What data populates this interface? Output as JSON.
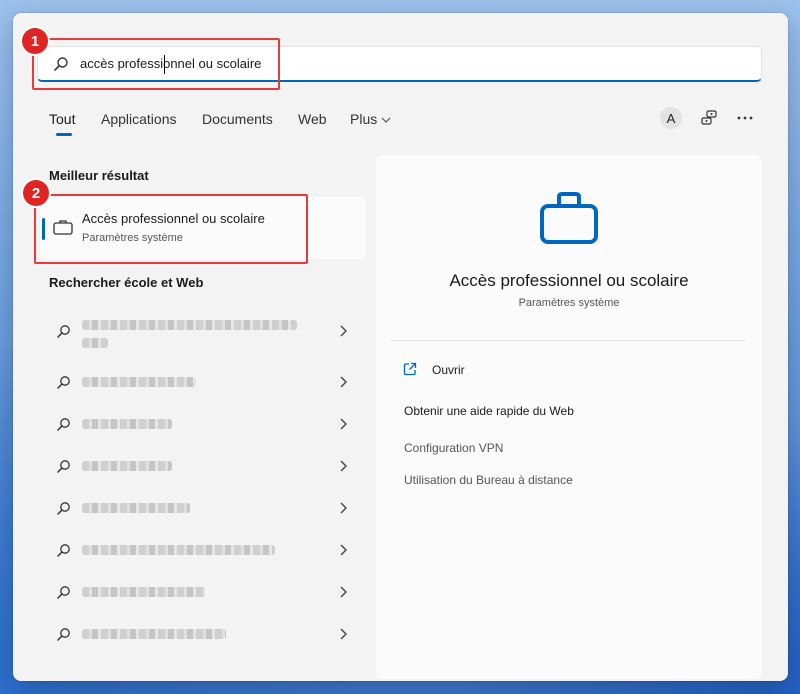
{
  "search": {
    "value": "accès professionnel ou scolaire"
  },
  "tabs": [
    {
      "label": "Tout"
    },
    {
      "label": "Applications"
    },
    {
      "label": "Documents"
    },
    {
      "label": "Web"
    },
    {
      "label": "Plus"
    }
  ],
  "toolbar": {
    "avatar_letter": "A"
  },
  "best_match": {
    "heading": "Meilleur résultat",
    "title": "Accès professionnel ou scolaire",
    "subtitle": "Paramètres système"
  },
  "web_section": {
    "heading": "Rechercher école et Web"
  },
  "details": {
    "title": "Accès professionnel ou scolaire",
    "subtitle": "Paramètres système",
    "open_label": "Ouvrir",
    "help_heading": "Obtenir une aide rapide du Web",
    "links": [
      "Configuration VPN",
      "Utilisation du Bureau à distance"
    ]
  },
  "callouts": [
    "1",
    "2"
  ],
  "colors": {
    "accent": "#0067c0",
    "callout": "#e02424"
  }
}
